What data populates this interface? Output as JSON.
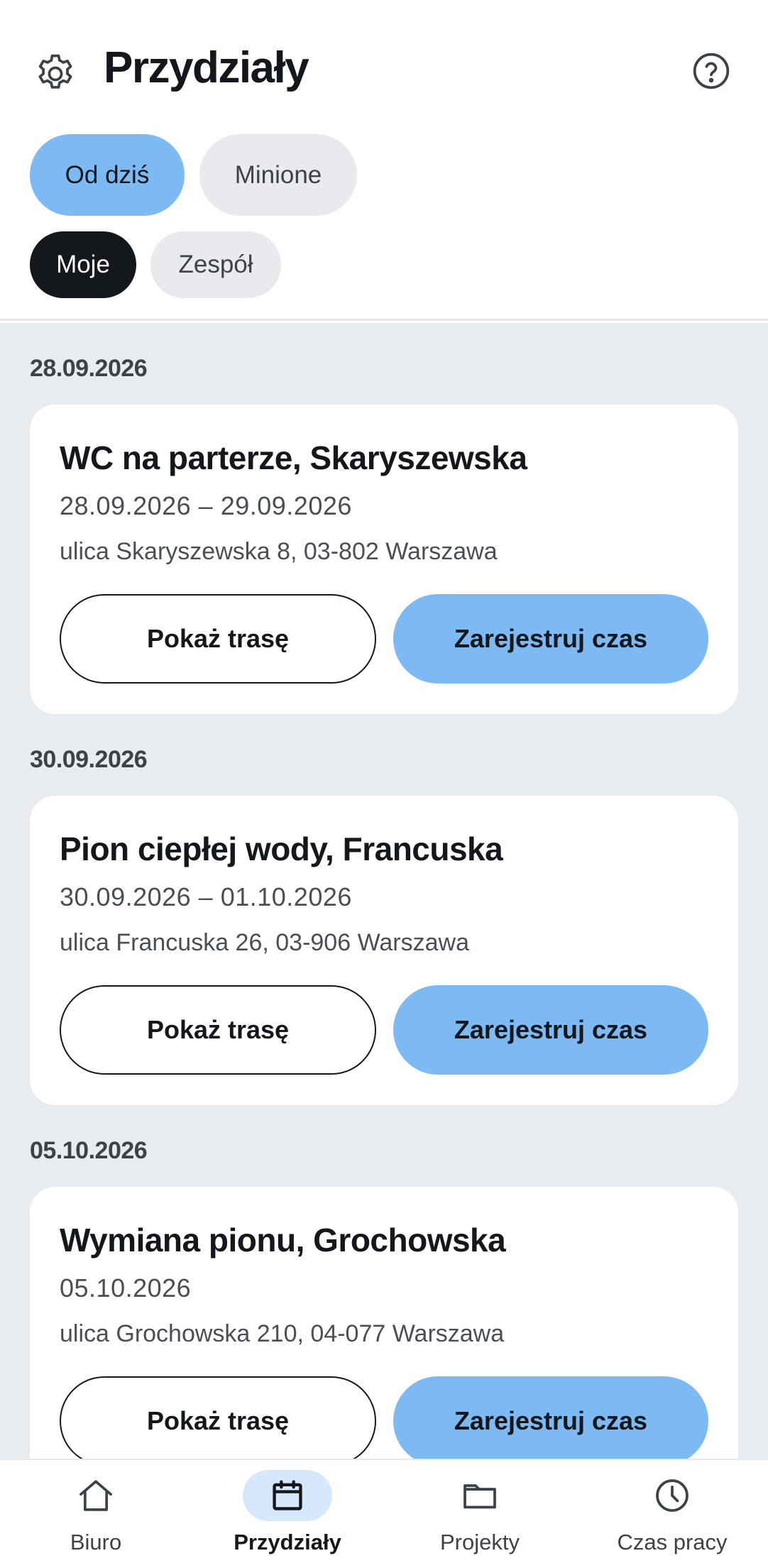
{
  "header": {
    "title": "Przydziały",
    "settings_icon": "gear-icon",
    "help_icon": "help-circle-icon"
  },
  "filters": {
    "period": [
      {
        "label": "Od dziś",
        "selected": true
      },
      {
        "label": "Minione",
        "selected": false
      }
    ],
    "scope": [
      {
        "label": "Moje",
        "selected": true
      },
      {
        "label": "Zespół",
        "selected": false
      }
    ]
  },
  "assignments": [
    {
      "date": "28.09.2026",
      "title": "WC na parterze, Skaryszewska",
      "range": "28.09.2026 – 29.09.2026",
      "address": "ulica Skaryszewska 8, 03-802 Warszawa",
      "route_label": "Pokaż trasę",
      "log_label": "Zarejestruj czas"
    },
    {
      "date": "30.09.2026",
      "title": "Pion ciepłej wody, Francuska",
      "range": "30.09.2026 – 01.10.2026",
      "address": "ulica Francuska 26, 03-906 Warszawa",
      "route_label": "Pokaż trasę",
      "log_label": "Zarejestruj czas"
    },
    {
      "date": "05.10.2026",
      "title": "Wymiana pionu, Grochowska",
      "range": "05.10.2026",
      "address": "ulica Grochowska 210, 04-077 Warszawa",
      "route_label": "Pokaż trasę",
      "log_label": "Zarejestruj czas"
    }
  ],
  "nav": [
    {
      "label": "Biuro",
      "icon": "home-icon",
      "active": false
    },
    {
      "label": "Przydziały",
      "icon": "calendar-icon",
      "active": true
    },
    {
      "label": "Projekty",
      "icon": "folder-icon",
      "active": false
    },
    {
      "label": "Czas pracy",
      "icon": "clock-icon",
      "active": false
    }
  ],
  "colors": {
    "accent": "#7db9f3",
    "accent_soft": "#d6e8fb",
    "dark": "#14171c",
    "list_background": "#e9ecef",
    "chip_inactive": "#e8eaed"
  }
}
